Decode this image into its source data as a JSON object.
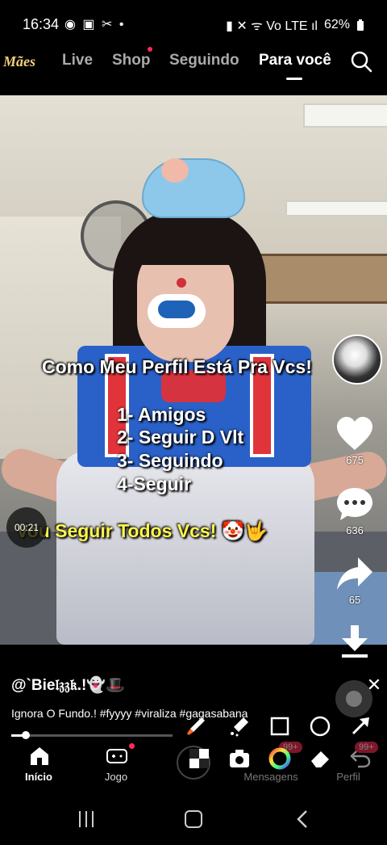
{
  "status_bar": {
    "time": "16:34",
    "notification_icons": "◉ ▣ ✂ •",
    "right_icons": "▮ ✕ ᯤ Vo LTE ıl",
    "battery": "62%"
  },
  "top_nav": {
    "tabs": [
      {
        "label": "Mães",
        "active": false
      },
      {
        "label": "Live",
        "active": false
      },
      {
        "label": "Shop",
        "active": false
      },
      {
        "label": "Seguindo",
        "active": false
      },
      {
        "label": "Para você",
        "active": true
      }
    ]
  },
  "video": {
    "overlay_title": "Como Meu Perfil Está Pra Vcs!",
    "list": [
      "1- Amigos",
      "2- Seguir D Vlt",
      "3- Seguindo",
      "4-Seguir"
    ],
    "bottom_text": "Vou Seguir Todos Vcs! 🤡🤟",
    "timestamp": "00:21"
  },
  "side_actions": {
    "likes": "675",
    "comments": "636",
    "shares": "65"
  },
  "post": {
    "author": "@`Bie𝔩𝔷𝔷𝔨.!👻🎩",
    "caption": "Ignora O Fundo.! #fyyyy #viraliza #gagasabana",
    "progress": 0.09
  },
  "bottom_nav": {
    "items": [
      {
        "label": "Início",
        "active": true
      },
      {
        "label": "Jogo",
        "active": false
      },
      {
        "label": "",
        "active": false
      },
      {
        "label": "Mensagens",
        "active": false
      },
      {
        "label": "Perfil",
        "active": false
      }
    ],
    "messages_badge": "99+",
    "profile_badge": "99+"
  },
  "colors": {
    "accent": "#fe2c55",
    "yellow_text": "#fff74a"
  }
}
